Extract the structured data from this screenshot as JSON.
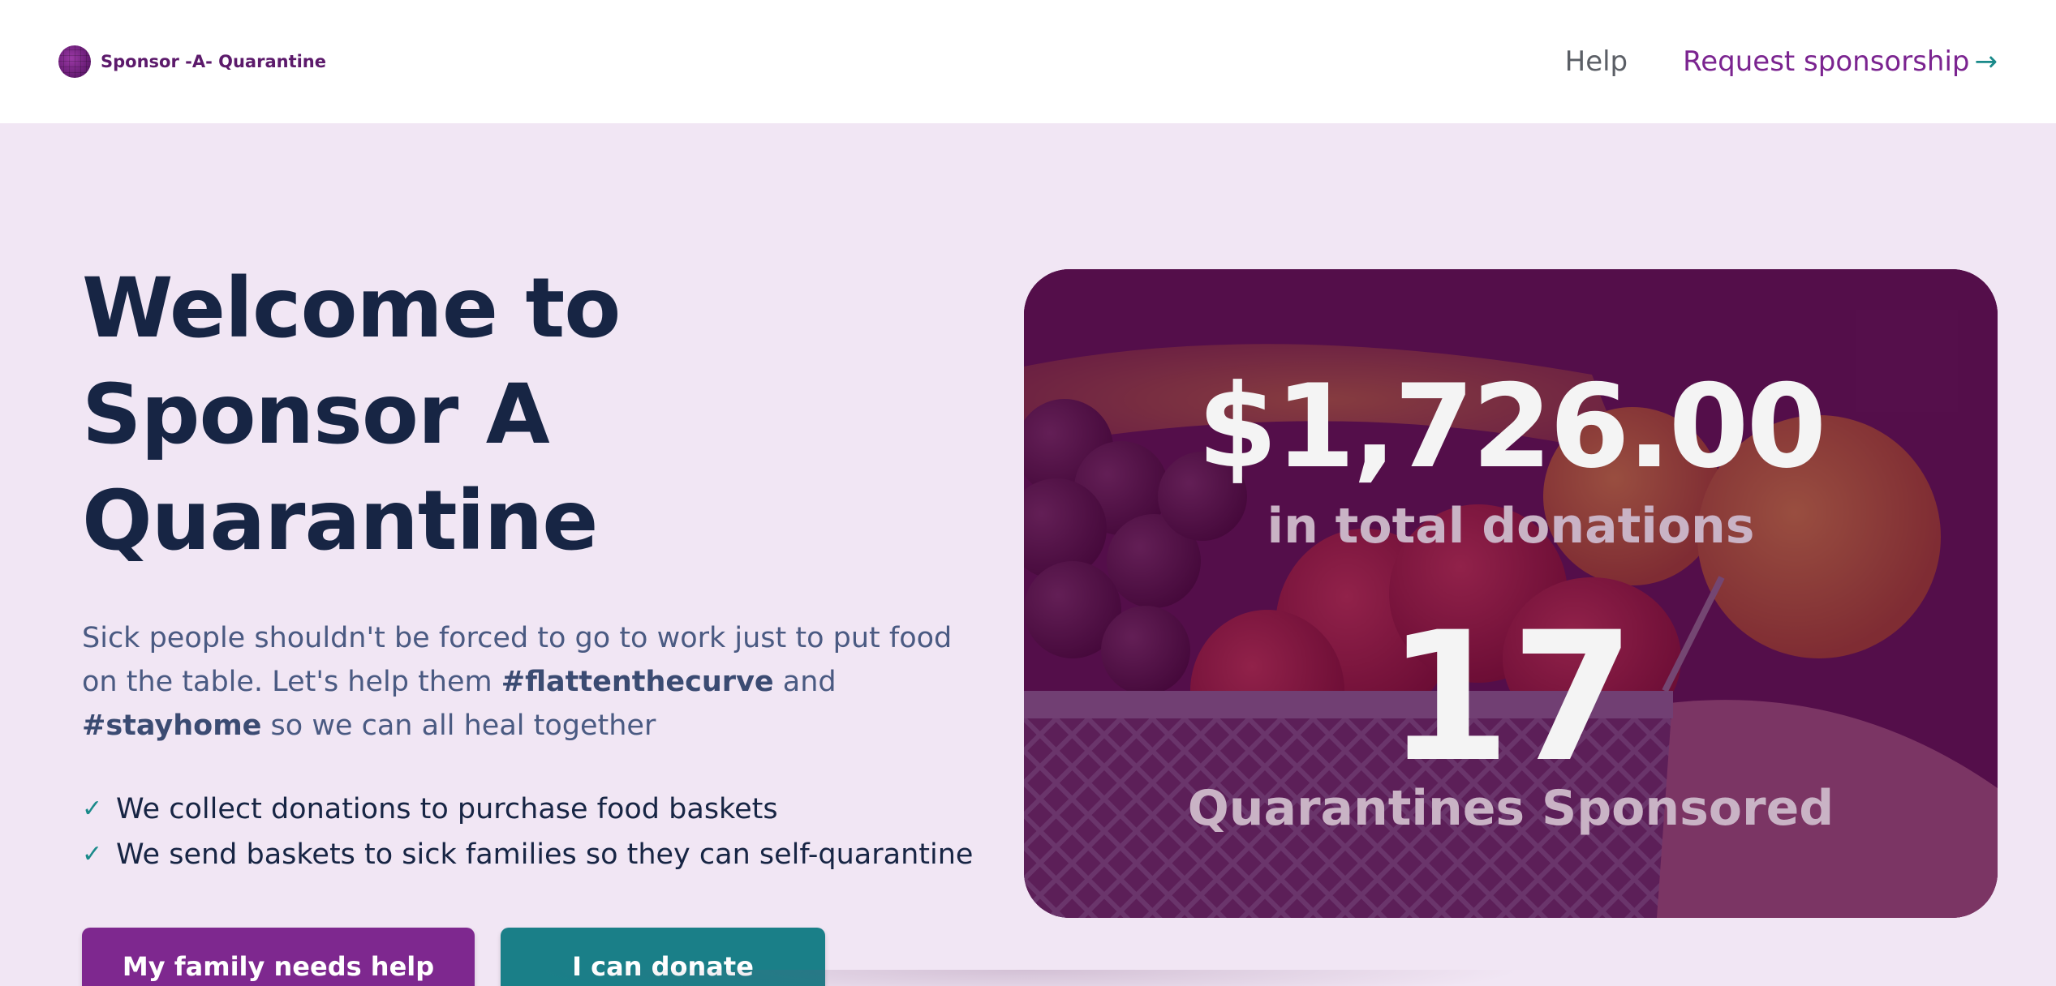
{
  "header": {
    "brand_name": "Sponsor -A- Quarantine",
    "nav_help": "Help",
    "nav_request": "Request sponsorship",
    "nav_request_icon": "arrow-right-icon"
  },
  "hero": {
    "title": "Welcome to Sponsor A Quarantine",
    "intro_part1": "Sick people shouldn't be forced to go to work just to put food on the table. Let's help them ",
    "hashtag1": "#flattenthecurve",
    "intro_part2": " and ",
    "hashtag2": "#stayhome",
    "intro_part3": " so we can all heal together",
    "checklist": [
      "We collect donations to purchase food baskets",
      "We send baskets to sick families so they can self-quarantine"
    ],
    "primary_button": "My family needs help",
    "secondary_button": "I can donate"
  },
  "stats": {
    "total_donations": "$1,726.00",
    "total_donations_label": "in total donations",
    "quarantines_count": "17",
    "quarantines_label": "Quarantines Sponsored"
  },
  "colors": {
    "brand_purple": "#7e288f",
    "brand_teal": "#1a7f88",
    "hero_background": "#f1e6f4",
    "heading_navy": "#172544"
  }
}
